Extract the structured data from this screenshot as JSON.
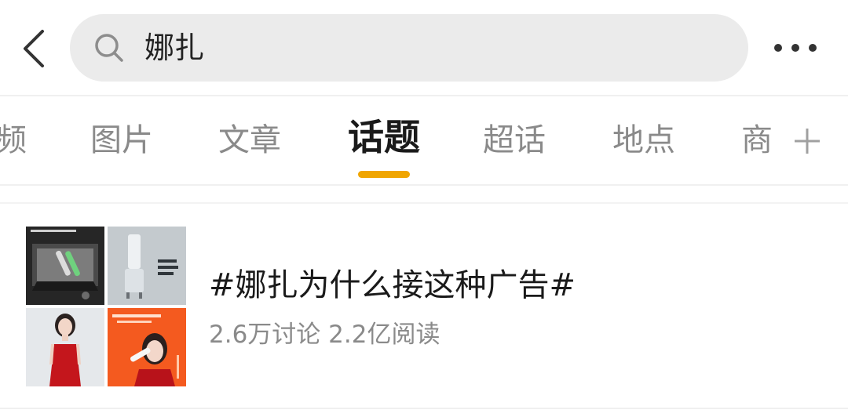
{
  "search": {
    "query": "娜扎"
  },
  "tabs": [
    {
      "label": "频"
    },
    {
      "label": "图片"
    },
    {
      "label": "文章"
    },
    {
      "label": "话题"
    },
    {
      "label": "超话"
    },
    {
      "label": "地点"
    },
    {
      "label": "商"
    }
  ],
  "active_tab": "话题",
  "accent_color": "#f0a500",
  "topic": {
    "title": "#娜扎为什么接这种广告#",
    "stats": "2.6万讨论 2.2亿阅读"
  },
  "icons": {
    "back": "chevron-left-icon",
    "search": "search-icon",
    "more": "more-horizontal-icon",
    "add": "plus-icon"
  }
}
